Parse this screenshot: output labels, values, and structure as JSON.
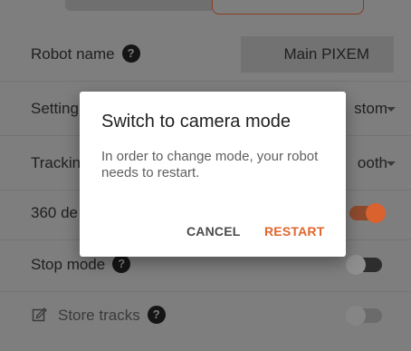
{
  "rows": {
    "robot_name": {
      "label": "Robot name",
      "help": "?",
      "value": "Main PIXEM"
    },
    "settings": {
      "label": "Setting",
      "value": "stom"
    },
    "tracking": {
      "label": "Trackin",
      "value": "ooth"
    },
    "degrees": {
      "label": "360 de",
      "toggle_on": true
    },
    "stop_mode": {
      "label": "Stop mode",
      "help": "?",
      "toggle_on": false
    },
    "store_tracks": {
      "label": "Store tracks",
      "help": "?",
      "toggle_on": false
    }
  },
  "dialog": {
    "title": "Switch to camera mode",
    "body": "In order to change mode, your robot needs to restart.",
    "cancel_label": "CANCEL",
    "restart_label": "RESTART"
  },
  "colors": {
    "accent": "#e0662e",
    "scrim": "#7e7e7e"
  }
}
